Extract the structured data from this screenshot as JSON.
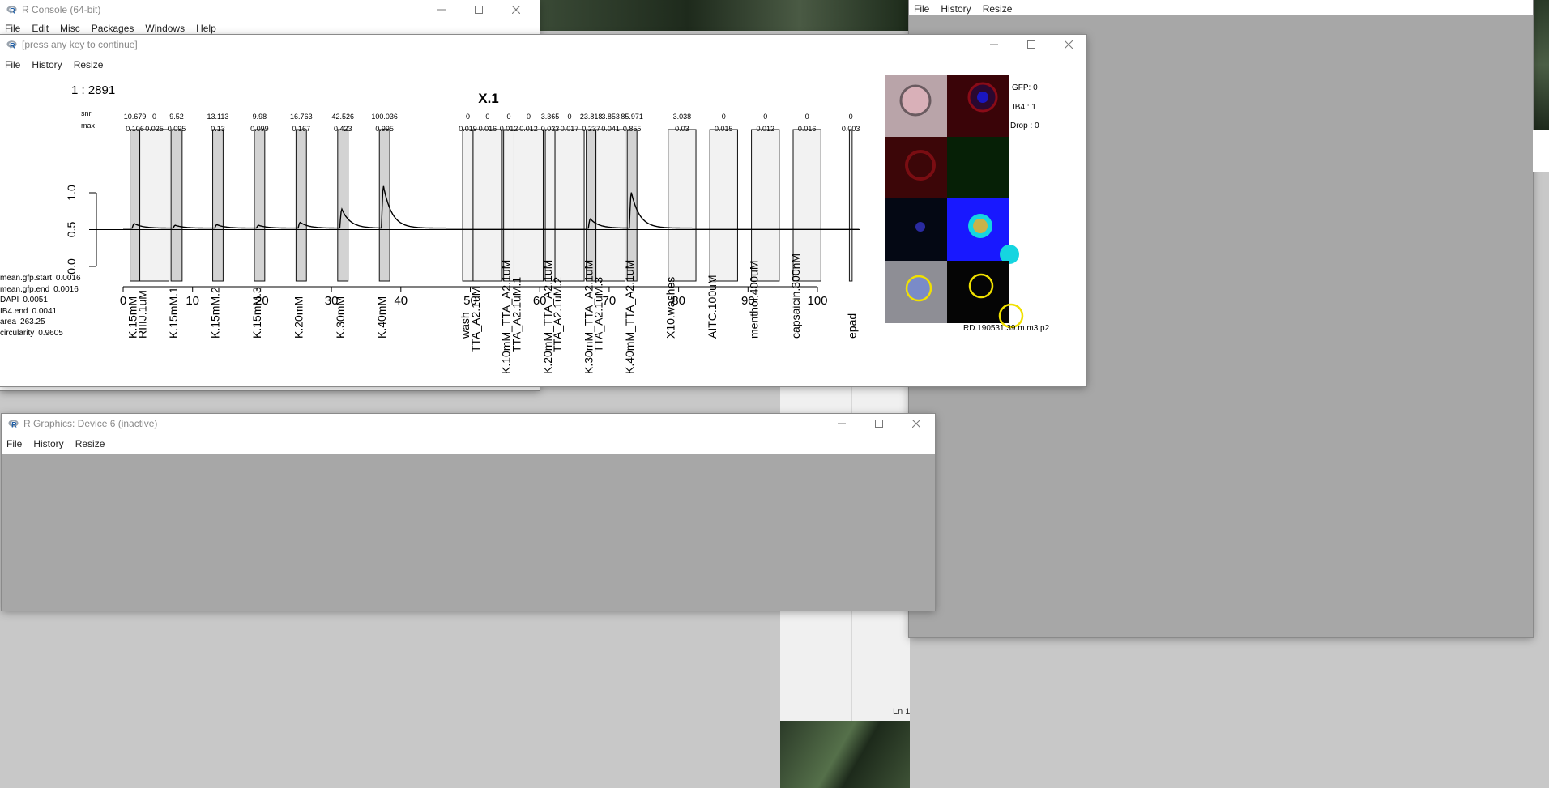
{
  "background": {
    "color": "#c8c8c8"
  },
  "console_window": {
    "title": "R Console (64-bit)",
    "menu": [
      "File",
      "Edit",
      "Misc",
      "Packages",
      "Windows",
      "Help"
    ]
  },
  "right_window": {
    "menu": [
      "File",
      "History",
      "Resize"
    ],
    "status_text": "Ln 1"
  },
  "main_window": {
    "title": "[press any key to continue]",
    "menu": [
      "File",
      "History",
      "Resize"
    ]
  },
  "device6_window": {
    "title": "R Graphics: Device 6 (inactive)",
    "menu": [
      "File",
      "History",
      "Resize"
    ]
  },
  "plot": {
    "counter": "1 : 2891",
    "title": "X.1",
    "row_labels": {
      "snr": "snr",
      "max": "max"
    },
    "stats": [
      {
        "label": "mean.gfp.start",
        "value": "0.0016"
      },
      {
        "label": "mean.gfp.end",
        "value": "0.0016"
      },
      {
        "label": "DAPI",
        "value": "0.0051"
      },
      {
        "label": "IB4.end",
        "value": "0.0041"
      },
      {
        "label": "area",
        "value": "263.25"
      },
      {
        "label": "circularity",
        "value": "0.9605"
      }
    ],
    "flags": [
      "GFP: 0",
      "IB4 : 1",
      "Drop : 0"
    ],
    "cell_id": "RD.190531.39.m.m3.p2",
    "thumbnail_colors": [
      "#b49aa0",
      "#3a0408",
      "#3c0608",
      "#062006",
      "#040814",
      "#1c1cff",
      "#8a8a90",
      "#050505"
    ]
  },
  "chart_data": {
    "type": "line",
    "title": "X.1",
    "xlim": [
      0,
      106
    ],
    "ylim": [
      0,
      1.1
    ],
    "xticks": [
      0,
      10,
      20,
      30,
      40,
      50,
      60,
      70,
      80,
      90,
      100
    ],
    "yticks": [
      "0.0",
      "0.5",
      "1.0"
    ],
    "baseline": 0.5,
    "windows": [
      {
        "label": "K.15mM",
        "start": 1.0,
        "end": 2.4,
        "snr": "10.679",
        "max": "0.106",
        "gray": true
      },
      {
        "label": "RIIIJ.1uM",
        "start": 2.4,
        "end": 6.6,
        "snr": "0",
        "max": "0.025",
        "gray": false
      },
      {
        "label": "K.15mM.1",
        "start": 6.9,
        "end": 8.5,
        "snr": "9.52",
        "max": "0.095",
        "gray": true
      },
      {
        "label": "K.15mM.2",
        "start": 12.9,
        "end": 14.4,
        "snr": "13.113",
        "max": "0.13",
        "gray": true
      },
      {
        "label": "K.15mM.3",
        "start": 18.9,
        "end": 20.4,
        "snr": "9.98",
        "max": "0.099",
        "gray": true
      },
      {
        "label": "K.20mM",
        "start": 24.9,
        "end": 26.4,
        "snr": "16.763",
        "max": "0.167",
        "gray": true
      },
      {
        "label": "K.30mM",
        "start": 30.9,
        "end": 32.4,
        "snr": "42.526",
        "max": "0.423",
        "gray": true
      },
      {
        "label": "K.40mM",
        "start": 36.9,
        "end": 38.4,
        "snr": "100.036",
        "max": "0.995",
        "gray": true
      },
      {
        "label": "wash",
        "start": 48.9,
        "end": 50.4,
        "snr": "0",
        "max": "0.019",
        "gray": false
      },
      {
        "label": "TTA_A2.1uM",
        "start": 50.4,
        "end": 54.6,
        "snr": "0",
        "max": "0.016",
        "gray": false
      },
      {
        "label": "K.10mM_TTA_A2.1uM",
        "start": 54.8,
        "end": 56.3,
        "snr": "0",
        "max": "0.012",
        "gray": false
      },
      {
        "label": "TTA_A2.1uM.1",
        "start": 56.3,
        "end": 60.5,
        "snr": "0",
        "max": "0.012",
        "gray": false
      },
      {
        "label": "K.20mM_TTA_A2.1uM",
        "start": 60.8,
        "end": 62.2,
        "snr": "3.365",
        "max": "0.033",
        "gray": false
      },
      {
        "label": "TTA_A2.1uM.2",
        "start": 62.2,
        "end": 66.4,
        "snr": "0",
        "max": "0.017",
        "gray": false
      },
      {
        "label": "K.30mM_TTA_A2.1uM",
        "start": 66.7,
        "end": 68.1,
        "snr": "23.818",
        "max": "0.237",
        "gray": true
      },
      {
        "label": "TTA_A2.1uM.3",
        "start": 68.1,
        "end": 72.3,
        "snr": "3.853",
        "max": "0.041",
        "gray": false
      },
      {
        "label": "K.40mM_TTA_A2.1uM",
        "start": 72.6,
        "end": 74.0,
        "snr": "85.971",
        "max": "0.855",
        "gray": true
      },
      {
        "label": "X10.washes",
        "start": 78.5,
        "end": 82.5,
        "snr": "3.038",
        "max": "0.03",
        "gray": false
      },
      {
        "label": "AITC.100uM",
        "start": 84.5,
        "end": 88.5,
        "snr": "0",
        "max": "0.015",
        "gray": false
      },
      {
        "label": "menthol.400uM",
        "start": 90.5,
        "end": 94.5,
        "snr": "0",
        "max": "0.012",
        "gray": false
      },
      {
        "label": "capsaicin.300nM",
        "start": 96.5,
        "end": 100.5,
        "snr": "0",
        "max": "0.016",
        "gray": false
      },
      {
        "label": "epad",
        "start": 104.6,
        "end": 105.0,
        "snr": "0",
        "max": "0.003",
        "gray": false
      }
    ],
    "peaks": [
      {
        "x": 1.3,
        "height": 0.08
      },
      {
        "x": 7.2,
        "height": 0.05
      },
      {
        "x": 13.2,
        "height": 0.06
      },
      {
        "x": 19.2,
        "height": 0.05
      },
      {
        "x": 25.2,
        "height": 0.1
      },
      {
        "x": 31.2,
        "height": 0.33
      },
      {
        "x": 37.2,
        "height": 0.73
      },
      {
        "x": 67.0,
        "height": 0.16
      },
      {
        "x": 72.9,
        "height": 0.62
      }
    ]
  }
}
